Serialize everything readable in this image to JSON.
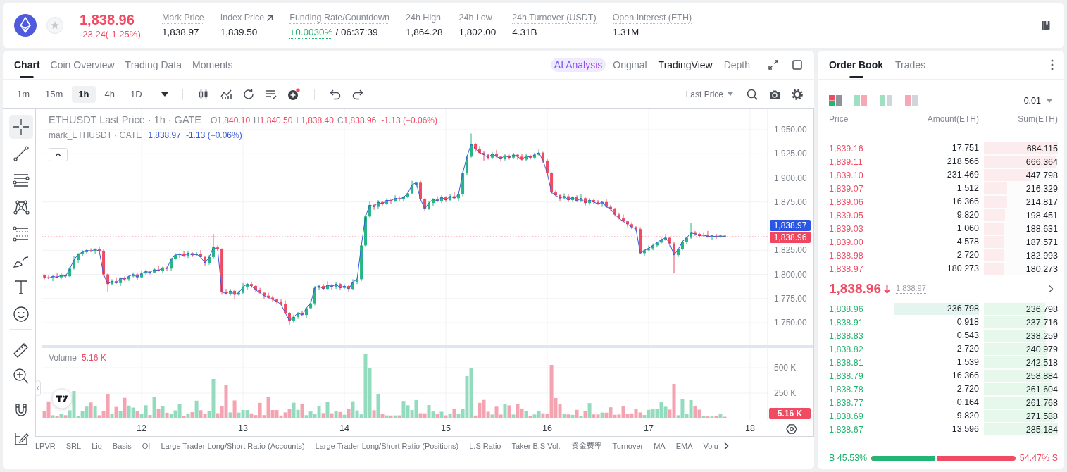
{
  "header": {
    "price": "1,838.96",
    "change": "-23.24(-1.25%)",
    "stats": [
      {
        "kind": "plain",
        "label": "Mark Price",
        "value": "1,838.97",
        "dotted": true
      },
      {
        "kind": "link",
        "label": "Index Price",
        "value": "1,839.50",
        "dotted": false
      },
      {
        "kind": "funding",
        "label": "Funding Rate/Countdown",
        "value": "+0.0030%",
        "countdown": "/ 06:37:39",
        "dotted": true
      },
      {
        "kind": "plain",
        "label": "24h High",
        "value": "1,864.28",
        "dotted": false
      },
      {
        "kind": "plain",
        "label": "24h Low",
        "value": "1,802.00",
        "dotted": false
      },
      {
        "kind": "plain",
        "label": "24h Turnover (USDT)",
        "value": "4.31B",
        "dotted": true
      },
      {
        "kind": "plain",
        "label": "Open Interest (ETH)",
        "value": "1.31M",
        "dotted": true
      }
    ]
  },
  "chart_panel": {
    "tabs": [
      {
        "label": "Chart",
        "selected": true
      },
      {
        "label": "Coin Overview",
        "selected": false
      },
      {
        "label": "Trading Data",
        "selected": false
      },
      {
        "label": "Moments",
        "selected": false
      }
    ],
    "analysis_button": "AI Analysis",
    "views": [
      {
        "label": "Original",
        "selected": false
      },
      {
        "label": "TradingView",
        "selected": true
      },
      {
        "label": "Depth",
        "selected": false
      }
    ],
    "intervals": [
      {
        "label": "1m",
        "selected": false
      },
      {
        "label": "15m",
        "selected": false
      },
      {
        "label": "1h",
        "selected": true
      },
      {
        "label": "4h",
        "selected": false
      },
      {
        "label": "1D",
        "selected": false
      }
    ],
    "price_source": "Last Price",
    "tools": [
      {
        "selected": true
      },
      {
        "selected": false
      },
      {
        "selected": false
      },
      {
        "selected": false
      },
      {
        "selected": false
      },
      {
        "selected": false
      },
      {
        "selected": false
      },
      {
        "selected": false
      },
      {
        "selected": false
      },
      {
        "selected": false
      },
      {
        "selected": false
      },
      {
        "selected": false
      }
    ],
    "main_legend": {
      "title": "ETHUSDT Last Price · 1h · GATE",
      "ohlc": [
        {
          "key": "O",
          "value": "1,840.10"
        },
        {
          "key": "H",
          "value": "1,840.50"
        },
        {
          "key": "L",
          "value": "1,838.40"
        },
        {
          "key": "C",
          "value": "1,838.96"
        }
      ],
      "change": "-1.13 (−0.06%)"
    },
    "chart_data": {
      "type": "candlestick",
      "x": [
        11.042,
        11.083,
        11.125,
        11.167,
        11.208,
        11.25,
        11.292,
        11.333,
        11.375,
        11.417,
        11.458,
        11.5,
        11.542,
        11.583,
        11.625,
        11.667,
        11.708,
        11.75,
        11.792,
        11.833,
        11.875,
        11.917,
        11.958,
        12,
        12.042,
        12.083,
        12.125,
        12.167,
        12.208,
        12.25,
        12.292,
        12.333,
        12.375,
        12.417,
        12.458,
        12.5,
        12.542,
        12.583,
        12.625,
        12.667,
        12.708,
        12.75,
        12.792,
        12.833,
        12.875,
        12.917,
        12.958,
        13,
        13.042,
        13.083,
        13.125,
        13.167,
        13.208,
        13.25,
        13.292,
        13.333,
        13.375,
        13.417,
        13.458,
        13.5,
        13.542,
        13.583,
        13.625,
        13.667,
        13.708,
        13.75,
        13.792,
        13.833,
        13.875,
        13.917,
        13.958,
        14,
        14.042,
        14.083,
        14.125,
        14.167,
        14.208,
        14.25,
        14.292,
        14.333,
        14.375,
        14.417,
        14.458,
        14.5,
        14.542,
        14.583,
        14.625,
        14.667,
        14.708,
        14.75,
        14.792,
        14.833,
        14.875,
        14.917,
        14.958,
        15,
        15.042,
        15.083,
        15.125,
        15.167,
        15.208,
        15.25,
        15.292,
        15.333,
        15.375,
        15.417,
        15.458,
        15.5,
        15.542,
        15.583,
        15.625,
        15.667,
        15.708,
        15.75,
        15.792,
        15.833,
        15.875,
        15.917,
        15.958,
        16,
        16.042,
        16.083,
        16.125,
        16.167,
        16.208,
        16.25,
        16.292,
        16.333,
        16.375,
        16.417,
        16.458,
        16.5,
        16.542,
        16.583,
        16.625,
        16.667,
        16.708,
        16.75,
        16.792,
        16.833,
        16.875,
        16.917,
        16.958,
        17,
        17.042,
        17.083,
        17.125,
        17.167,
        17.208,
        17.25,
        17.292,
        17.333,
        17.375,
        17.417,
        17.458,
        17.5,
        17.542,
        17.583,
        17.625,
        17.667,
        17.708,
        17.75
      ],
      "ohlc": [
        [
          1799,
          1800,
          1795,
          1797
        ],
        [
          1797,
          1799,
          1795,
          1796
        ],
        [
          1796,
          1799,
          1793,
          1798
        ],
        [
          1798,
          1801,
          1796,
          1797
        ],
        [
          1797,
          1801,
          1795,
          1799
        ],
        [
          1799,
          1800,
          1796,
          1798
        ],
        [
          1798,
          1808,
          1797,
          1806
        ],
        [
          1806,
          1819,
          1805,
          1815
        ],
        [
          1815,
          1822,
          1812,
          1821
        ],
        [
          1821,
          1825,
          1819,
          1823
        ],
        [
          1823,
          1826,
          1821,
          1825
        ],
        [
          1825,
          1827,
          1823,
          1824
        ],
        [
          1824,
          1827,
          1821,
          1826
        ],
        [
          1826,
          1829,
          1823,
          1824
        ],
        [
          1824,
          1826,
          1798,
          1800
        ],
        [
          1800,
          1801,
          1782,
          1790
        ],
        [
          1790,
          1795,
          1789,
          1793
        ],
        [
          1793,
          1797,
          1790,
          1791
        ],
        [
          1791,
          1797,
          1788,
          1796
        ],
        [
          1796,
          1798,
          1793,
          1795
        ],
        [
          1795,
          1799,
          1793,
          1798
        ],
        [
          1798,
          1802,
          1797,
          1800
        ],
        [
          1800,
          1801,
          1794,
          1797
        ],
        [
          1797,
          1804,
          1796,
          1801
        ],
        [
          1801,
          1805,
          1799,
          1803
        ],
        [
          1803,
          1804,
          1800,
          1802
        ],
        [
          1802,
          1807,
          1801,
          1805
        ],
        [
          1805,
          1809,
          1803,
          1804
        ],
        [
          1804,
          1808,
          1801,
          1807
        ],
        [
          1807,
          1809,
          1804,
          1806
        ],
        [
          1806,
          1817,
          1804,
          1816
        ],
        [
          1816,
          1822,
          1815,
          1820
        ],
        [
          1820,
          1822,
          1817,
          1821
        ],
        [
          1821,
          1824,
          1818,
          1819
        ],
        [
          1819,
          1824,
          1817,
          1822
        ],
        [
          1822,
          1823,
          1818,
          1820
        ],
        [
          1820,
          1823,
          1819,
          1821
        ],
        [
          1821,
          1825,
          1817,
          1818
        ],
        [
          1818,
          1819,
          1809,
          1812
        ],
        [
          1812,
          1820,
          1810,
          1818
        ],
        [
          1818,
          1842,
          1816,
          1828
        ],
        [
          1828,
          1830,
          1825,
          1826
        ],
        [
          1826,
          1827,
          1779,
          1782
        ],
        [
          1782,
          1785,
          1779,
          1780
        ],
        [
          1780,
          1785,
          1778,
          1783
        ],
        [
          1783,
          1784,
          1774,
          1779
        ],
        [
          1779,
          1783,
          1778,
          1781
        ],
        [
          1781,
          1791,
          1780,
          1787
        ],
        [
          1787,
          1791,
          1784,
          1790
        ],
        [
          1790,
          1792,
          1786,
          1788
        ],
        [
          1788,
          1789,
          1782,
          1784
        ],
        [
          1784,
          1786,
          1780,
          1781
        ],
        [
          1781,
          1782,
          1775,
          1778
        ],
        [
          1778,
          1781,
          1775,
          1776
        ],
        [
          1776,
          1778,
          1772,
          1774
        ],
        [
          1774,
          1775,
          1770,
          1772
        ],
        [
          1772,
          1774,
          1768,
          1769
        ],
        [
          1769,
          1773,
          1759,
          1760
        ],
        [
          1760,
          1761,
          1748,
          1752
        ],
        [
          1752,
          1758,
          1750,
          1756
        ],
        [
          1756,
          1761,
          1754,
          1760
        ],
        [
          1760,
          1762,
          1757,
          1758
        ],
        [
          1758,
          1766,
          1755,
          1765
        ],
        [
          1765,
          1773,
          1764,
          1770
        ],
        [
          1770,
          1788,
          1768,
          1786
        ],
        [
          1786,
          1789,
          1784,
          1788
        ],
        [
          1788,
          1790,
          1784,
          1785
        ],
        [
          1785,
          1793,
          1784,
          1789
        ],
        [
          1789,
          1790,
          1784,
          1787
        ],
        [
          1787,
          1792,
          1785,
          1790
        ],
        [
          1790,
          1791,
          1784,
          1786
        ],
        [
          1786,
          1790,
          1785,
          1788
        ],
        [
          1788,
          1789,
          1782,
          1785
        ],
        [
          1785,
          1795,
          1784,
          1792
        ],
        [
          1792,
          1797,
          1790,
          1795
        ],
        [
          1795,
          1831,
          1793,
          1830
        ],
        [
          1830,
          1862,
          1829,
          1860
        ],
        [
          1860,
          1876,
          1859,
          1872
        ],
        [
          1872,
          1873,
          1867,
          1870
        ],
        [
          1870,
          1877,
          1868,
          1875
        ],
        [
          1875,
          1876,
          1871,
          1873
        ],
        [
          1873,
          1879,
          1872,
          1877
        ],
        [
          1877,
          1878,
          1873,
          1876
        ],
        [
          1876,
          1882,
          1875,
          1879
        ],
        [
          1879,
          1881,
          1876,
          1878
        ],
        [
          1878,
          1881,
          1876,
          1880
        ],
        [
          1880,
          1886,
          1879,
          1884
        ],
        [
          1884,
          1897,
          1883,
          1893
        ],
        [
          1893,
          1896,
          1890,
          1895
        ],
        [
          1895,
          1897,
          1876,
          1878
        ],
        [
          1878,
          1879,
          1866,
          1868
        ],
        [
          1868,
          1876,
          1867,
          1874
        ],
        [
          1874,
          1879,
          1871,
          1878
        ],
        [
          1878,
          1881,
          1875,
          1876
        ],
        [
          1876,
          1882,
          1874,
          1880
        ],
        [
          1880,
          1881,
          1875,
          1877
        ],
        [
          1877,
          1883,
          1876,
          1881
        ],
        [
          1881,
          1885,
          1878,
          1879
        ],
        [
          1879,
          1884,
          1876,
          1883
        ],
        [
          1883,
          1907,
          1881,
          1905
        ],
        [
          1905,
          1923,
          1903,
          1922
        ],
        [
          1922,
          1946,
          1921,
          1935
        ],
        [
          1935,
          1936,
          1927,
          1930
        ],
        [
          1930,
          1933,
          1925,
          1926
        ],
        [
          1926,
          1928,
          1918,
          1924
        ],
        [
          1924,
          1925,
          1919,
          1921
        ],
        [
          1921,
          1927,
          1920,
          1925
        ],
        [
          1925,
          1929,
          1921,
          1922
        ],
        [
          1922,
          1923,
          1917,
          1920
        ],
        [
          1920,
          1925,
          1918,
          1923
        ],
        [
          1923,
          1924,
          1919,
          1921
        ],
        [
          1921,
          1926,
          1920,
          1924
        ],
        [
          1924,
          1925,
          1919,
          1922
        ],
        [
          1922,
          1925,
          1918,
          1919
        ],
        [
          1919,
          1925,
          1917,
          1923
        ],
        [
          1923,
          1924,
          1919,
          1921
        ],
        [
          1921,
          1926,
          1920,
          1924
        ],
        [
          1924,
          1930,
          1923,
          1926
        ],
        [
          1926,
          1927,
          1915,
          1918
        ],
        [
          1918,
          1920,
          1903,
          1905
        ],
        [
          1905,
          1906,
          1883,
          1885
        ],
        [
          1885,
          1887,
          1881,
          1882
        ],
        [
          1882,
          1883,
          1876,
          1879
        ],
        [
          1879,
          1884,
          1878,
          1881
        ],
        [
          1881,
          1883,
          1875,
          1877
        ],
        [
          1877,
          1881,
          1875,
          1880
        ],
        [
          1880,
          1882,
          1875,
          1876
        ],
        [
          1876,
          1883,
          1875,
          1879
        ],
        [
          1879,
          1880,
          1871,
          1874
        ],
        [
          1874,
          1879,
          1872,
          1877
        ],
        [
          1877,
          1878,
          1873,
          1875
        ],
        [
          1875,
          1877,
          1872,
          1873
        ],
        [
          1873,
          1876,
          1870,
          1875
        ],
        [
          1875,
          1878,
          1869,
          1870
        ],
        [
          1870,
          1872,
          1866,
          1868
        ],
        [
          1868,
          1869,
          1860,
          1862
        ],
        [
          1862,
          1864,
          1857,
          1858
        ],
        [
          1858,
          1862,
          1854,
          1855
        ],
        [
          1855,
          1856,
          1849,
          1852
        ],
        [
          1852,
          1854,
          1847,
          1849
        ],
        [
          1849,
          1850,
          1845,
          1847
        ],
        [
          1847,
          1849,
          1821,
          1822
        ],
        [
          1822,
          1826,
          1819,
          1825
        ],
        [
          1825,
          1830,
          1824,
          1827
        ],
        [
          1827,
          1832,
          1825,
          1830
        ],
        [
          1830,
          1834,
          1828,
          1833
        ],
        [
          1833,
          1838,
          1832,
          1836
        ],
        [
          1836,
          1842,
          1835,
          1838
        ],
        [
          1838,
          1839,
          1829,
          1832
        ],
        [
          1832,
          1834,
          1801,
          1820
        ],
        [
          1820,
          1827,
          1818,
          1826
        ],
        [
          1826,
          1836,
          1825,
          1834
        ],
        [
          1834,
          1839,
          1831,
          1838
        ],
        [
          1838,
          1853,
          1837,
          1843
        ],
        [
          1843,
          1845,
          1840,
          1842
        ],
        [
          1842,
          1843,
          1838,
          1840
        ],
        [
          1840,
          1843,
          1839,
          1841
        ],
        [
          1841,
          1845,
          1838,
          1839
        ],
        [
          1839,
          1841,
          1836,
          1840
        ],
        [
          1840,
          1842,
          1837,
          1839
        ],
        [
          1839,
          1841,
          1838,
          1840
        ],
        [
          1840.1,
          1840.5,
          1838.4,
          1838.96
        ]
      ],
      "grid": true,
      "xlim": [
        10.951,
        18.632
      ],
      "ylim": [
        1631.8,
        1971.9
      ],
      "xticks": [
        12,
        13,
        14,
        15,
        16,
        17,
        18
      ],
      "yticks": [
        {
          "value": 1950,
          "label": "1,950.00"
        },
        {
          "value": 1925,
          "label": "1,925.00"
        },
        {
          "value": 1900,
          "label": "1,900.00"
        },
        {
          "value": 1875,
          "label": "1,875.00"
        },
        {
          "value": 1825,
          "label": "1,825.00"
        },
        {
          "value": 1800,
          "label": "1,800.00"
        },
        {
          "value": 1775,
          "label": "1,775.00"
        },
        {
          "value": 1750,
          "label": "1,750.00"
        }
      ]
    },
    "mark_legend": {
      "value": "1,838.97",
      "change": "-1.13 (−0.06%)",
      "chart_data": {
        "type": "line",
        "x": [
          11.042,
          11.083,
          11.125,
          11.167,
          11.208,
          11.25,
          11.292,
          11.333,
          11.375,
          11.417,
          11.458,
          11.5,
          11.542,
          11.583,
          11.625,
          11.667,
          11.708,
          11.75,
          11.792,
          11.833,
          11.875,
          11.917,
          11.958,
          12,
          12.042,
          12.083,
          12.125,
          12.167,
          12.208,
          12.25,
          12.292,
          12.333,
          12.375,
          12.417,
          12.458,
          12.5,
          12.542,
          12.583,
          12.625,
          12.667,
          12.708,
          12.75,
          12.792,
          12.833,
          12.875,
          12.917,
          12.958,
          13,
          13.042,
          13.083,
          13.125,
          13.167,
          13.208,
          13.25,
          13.292,
          13.333,
          13.375,
          13.417,
          13.458,
          13.5,
          13.542,
          13.583,
          13.625,
          13.667,
          13.708,
          13.75,
          13.792,
          13.833,
          13.875,
          13.917,
          13.958,
          14,
          14.042,
          14.083,
          14.125,
          14.167,
          14.208,
          14.25,
          14.292,
          14.333,
          14.375,
          14.417,
          14.458,
          14.5,
          14.542,
          14.583,
          14.625,
          14.667,
          14.708,
          14.75,
          14.792,
          14.833,
          14.875,
          14.917,
          14.958,
          15,
          15.042,
          15.083,
          15.125,
          15.167,
          15.208,
          15.25,
          15.292,
          15.333,
          15.375,
          15.417,
          15.458,
          15.5,
          15.542,
          15.583,
          15.625,
          15.667,
          15.708,
          15.75,
          15.792,
          15.833,
          15.875,
          15.917,
          15.958,
          16,
          16.042,
          16.083,
          16.125,
          16.167,
          16.208,
          16.25,
          16.292,
          16.333,
          16.375,
          16.417,
          16.458,
          16.5,
          16.542,
          16.583,
          16.625,
          16.667,
          16.708,
          16.75,
          16.792,
          16.833,
          16.875,
          16.917,
          16.958,
          17,
          17.042,
          17.083,
          17.125,
          17.167,
          17.208,
          17.25,
          17.292,
          17.333,
          17.375,
          17.417,
          17.458,
          17.5,
          17.542,
          17.583,
          17.625,
          17.667,
          17.708,
          17.75
        ],
        "series": [
          {
            "name": "mark_ETHUSDT · GATE",
            "color": "#3b5bdb",
            "values": [
              1797,
              1796,
              1798,
              1797,
              1799,
              1798,
              1806,
              1815,
              1821,
              1823,
              1825,
              1824,
              1826,
              1824,
              1800,
              1790,
              1793,
              1791,
              1796,
              1795,
              1798,
              1800,
              1797,
              1801,
              1803,
              1802,
              1805,
              1804,
              1807,
              1806,
              1816,
              1820,
              1821,
              1819,
              1822,
              1820,
              1821,
              1818,
              1812,
              1818,
              1828,
              1826,
              1782,
              1780,
              1783,
              1779,
              1781,
              1787,
              1790,
              1788,
              1784,
              1781,
              1778,
              1776,
              1774,
              1772,
              1769,
              1760,
              1752,
              1756,
              1760,
              1758,
              1765,
              1770,
              1786,
              1788,
              1785,
              1789,
              1787,
              1790,
              1786,
              1788,
              1785,
              1792,
              1795,
              1830,
              1860,
              1872,
              1870,
              1875,
              1873,
              1877,
              1876,
              1879,
              1878,
              1880,
              1884,
              1893,
              1895,
              1878,
              1868,
              1874,
              1878,
              1876,
              1880,
              1877,
              1881,
              1879,
              1883,
              1905,
              1922,
              1935,
              1930,
              1926,
              1924,
              1921,
              1925,
              1922,
              1920,
              1923,
              1921,
              1924,
              1922,
              1919,
              1923,
              1921,
              1924,
              1926,
              1918,
              1905,
              1885,
              1882,
              1879,
              1881,
              1877,
              1880,
              1876,
              1879,
              1874,
              1877,
              1875,
              1873,
              1875,
              1870,
              1868,
              1862,
              1858,
              1855,
              1852,
              1849,
              1847,
              1822,
              1825,
              1827,
              1830,
              1833,
              1836,
              1838,
              1832,
              1820,
              1826,
              1834,
              1838,
              1843,
              1842,
              1840,
              1841,
              1839,
              1840,
              1839,
              1840,
              1839
            ]
          }
        ],
        "xlim": [
          10.951,
          18.632
        ],
        "ylim": [
          1631.8,
          1971.9
        ]
      }
    },
    "price_tags": [
      {
        "value": "1,838.97",
        "color": "#2b56e3"
      },
      {
        "value": "1,838.96",
        "color": "#f0465f"
      }
    ],
    "volume": {
      "label": "Volume",
      "value": "5.16 K",
      "axis": [
        "500 K",
        "250 K"
      ],
      "tag": "5.16 K"
    },
    "indicators": [
      "LPVR",
      "SRL",
      "Liq",
      "Basis",
      "OI",
      "Large Trader Long/Short Ratio (Accounts)",
      "Large Trader Long/Short Ratio (Positions)",
      "L.S Ratio",
      "Taker B.S Vol.",
      "资金费率",
      "Turnover",
      "MA",
      "EMA",
      "Volu"
    ]
  },
  "order_book": {
    "tabs": [
      {
        "label": "Order Book",
        "selected": true
      },
      {
        "label": "Trades",
        "selected": false
      }
    ],
    "layouts": [
      {
        "selected": true
      },
      {
        "selected": false
      },
      {
        "selected": false
      },
      {
        "selected": false
      }
    ],
    "precision": "0.01",
    "columns": [
      "Price",
      "Amount(ETH)",
      "Sum(ETH)"
    ],
    "asks": [
      {
        "price": "1,839.16",
        "amount": "17.751",
        "sum": "684.115",
        "level": 1.0,
        "highlighted": false
      },
      {
        "price": "1,839.11",
        "amount": "218.566",
        "sum": "666.364",
        "level": 0.974,
        "highlighted": false
      },
      {
        "price": "1,839.10",
        "amount": "231.469",
        "sum": "447.798",
        "level": 0.655,
        "highlighted": false
      },
      {
        "price": "1,839.07",
        "amount": "1.512",
        "sum": "216.329",
        "level": 0.316,
        "highlighted": false
      },
      {
        "price": "1,839.06",
        "amount": "16.366",
        "sum": "214.817",
        "level": 0.314,
        "highlighted": false
      },
      {
        "price": "1,839.05",
        "amount": "9.820",
        "sum": "198.451",
        "level": 0.29,
        "highlighted": false
      },
      {
        "price": "1,839.03",
        "amount": "1.060",
        "sum": "188.631",
        "level": 0.276,
        "highlighted": false
      },
      {
        "price": "1,839.00",
        "amount": "4.578",
        "sum": "187.571",
        "level": 0.274,
        "highlighted": false
      },
      {
        "price": "1,838.98",
        "amount": "2.720",
        "sum": "182.993",
        "level": 0.267,
        "highlighted": false
      },
      {
        "price": "1,838.97",
        "amount": "180.273",
        "sum": "180.273",
        "level": 0.264,
        "highlighted": false
      }
    ],
    "last_price": "1,838.96",
    "mark_price": "1,838.97",
    "bids": [
      {
        "price": "1,838.96",
        "amount": "236.798",
        "sum": "236.798",
        "level": 0.83,
        "highlighted": true
      },
      {
        "price": "1,838.91",
        "amount": "0.918",
        "sum": "237.716",
        "level": 0.834,
        "highlighted": false
      },
      {
        "price": "1,838.83",
        "amount": "0.543",
        "sum": "238.259",
        "level": 0.835,
        "highlighted": false
      },
      {
        "price": "1,838.82",
        "amount": "2.720",
        "sum": "240.979",
        "level": 0.845,
        "highlighted": false
      },
      {
        "price": "1,838.81",
        "amount": "1.539",
        "sum": "242.518",
        "level": 0.85,
        "highlighted": false
      },
      {
        "price": "1,838.79",
        "amount": "16.366",
        "sum": "258.884",
        "level": 0.908,
        "highlighted": false
      },
      {
        "price": "1,838.78",
        "amount": "2.720",
        "sum": "261.604",
        "level": 0.917,
        "highlighted": false
      },
      {
        "price": "1,838.77",
        "amount": "0.164",
        "sum": "261.768",
        "level": 0.918,
        "highlighted": false
      },
      {
        "price": "1,838.69",
        "amount": "9.820",
        "sum": "271.588",
        "level": 0.952,
        "highlighted": false
      },
      {
        "price": "1,838.67",
        "amount": "13.596",
        "sum": "285.184",
        "level": 1.0,
        "highlighted": false
      }
    ],
    "ratio": {
      "buy": "B 45.53%",
      "sell": "54.47% S",
      "level": 0.4553
    }
  }
}
